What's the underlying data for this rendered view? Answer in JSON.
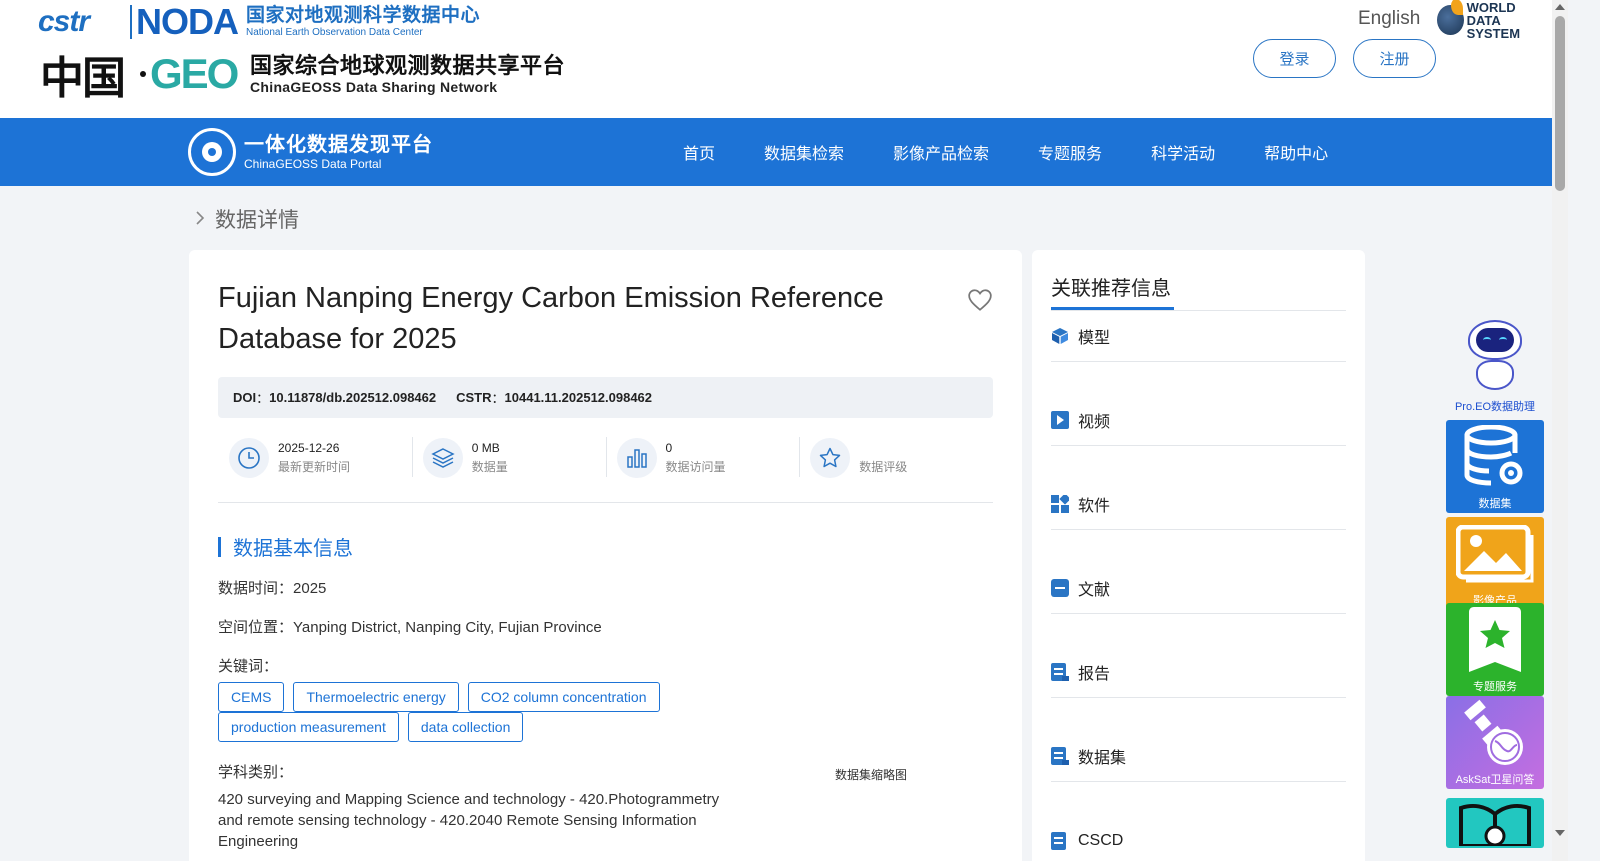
{
  "header": {
    "cstr_logo": "cstr",
    "noda_logo": "NODA",
    "noda_cn": "国家对地观测科学数据中心",
    "noda_en": "National Earth Observation Data Center",
    "china_geo_cn": "中国",
    "geo_logo": "GEO",
    "geoss_cn": "国家综合地球观测数据共享平台",
    "geoss_en": "ChinaGEOSS Data Sharing Network",
    "language": "English",
    "wds_line1": "WORLD",
    "wds_line2": "DATA SYSTEM",
    "login_label": "登录",
    "register_label": "注册"
  },
  "nav": {
    "portal_cn": "一体化数据发现平台",
    "portal_en": "ChinaGEOSS Data Portal",
    "items": [
      "首页",
      "数据集检索",
      "影像产品检索",
      "专题服务",
      "科学活动",
      "帮助中心"
    ]
  },
  "breadcrumb": {
    "current": "数据详情"
  },
  "detail": {
    "title": "Fujian Nanping Energy Carbon Emission Reference Database for 2025",
    "doi_label": "DOI",
    "doi_value": "10.11878/db.202512.098462",
    "cstr_label": "CSTR",
    "cstr_value": "10441.11.202512.098462",
    "colon": "：",
    "stats": [
      {
        "value": "2025-12-26",
        "label": "最新更新时间",
        "icon": "clock-icon"
      },
      {
        "value": "0 MB",
        "label": "数据量",
        "icon": "layers-icon"
      },
      {
        "value": "0",
        "label": "数据访问量",
        "icon": "bar-chart-icon"
      },
      {
        "value": "",
        "label": "数据评级",
        "icon": "star-icon"
      }
    ],
    "section_title": "数据基本信息",
    "time_label": "数据时间：",
    "time_value": "2025",
    "location_label": "空间位置：",
    "location_value": "Yanping District, Nanping City, Fujian Province",
    "keywords_label": "关键词：",
    "keywords": [
      "CEMS",
      "Thermoelectric energy",
      "CO2 column concentration",
      "production measurement",
      "data collection"
    ],
    "subject_label": "学科类别：",
    "subject_value": "420 surveying and Mapping Science and technology - 420.Photogrammetry and remote sensing technology - 420.2040 Remote Sensing Information Engineering",
    "thumbnail_label": "数据集缩略图"
  },
  "sidebar": {
    "title": "关联推荐信息",
    "items": [
      {
        "label": "模型",
        "icon": "cube-icon"
      },
      {
        "label": "视频",
        "icon": "play-icon"
      },
      {
        "label": "软件",
        "icon": "apps-icon"
      },
      {
        "label": "文献",
        "icon": "document-icon"
      },
      {
        "label": "报告",
        "icon": "report-icon"
      },
      {
        "label": "数据集",
        "icon": "dataset-icon"
      },
      {
        "label": "CSCD",
        "icon": "cscd-icon"
      }
    ]
  },
  "float_tools": {
    "assistant_label": "Pro.EO数据助理",
    "buttons": [
      {
        "label": "数据集",
        "color": "#1d73d6",
        "icon": "database-gear-icon"
      },
      {
        "label": "影像产品",
        "color": "#f0a41a",
        "icon": "image-icon"
      },
      {
        "label": "专题服务",
        "color": "#2cb32c",
        "icon": "star-bookmark-icon"
      },
      {
        "label": "AskSat卫星问答",
        "color": "#a06ce0",
        "icon": "satellite-globe-icon"
      },
      {
        "label": "",
        "color": "#22c7c0",
        "icon": "book-icon"
      }
    ]
  },
  "colors": {
    "primary": "#1d73d6",
    "background": "#f2f4f7"
  }
}
